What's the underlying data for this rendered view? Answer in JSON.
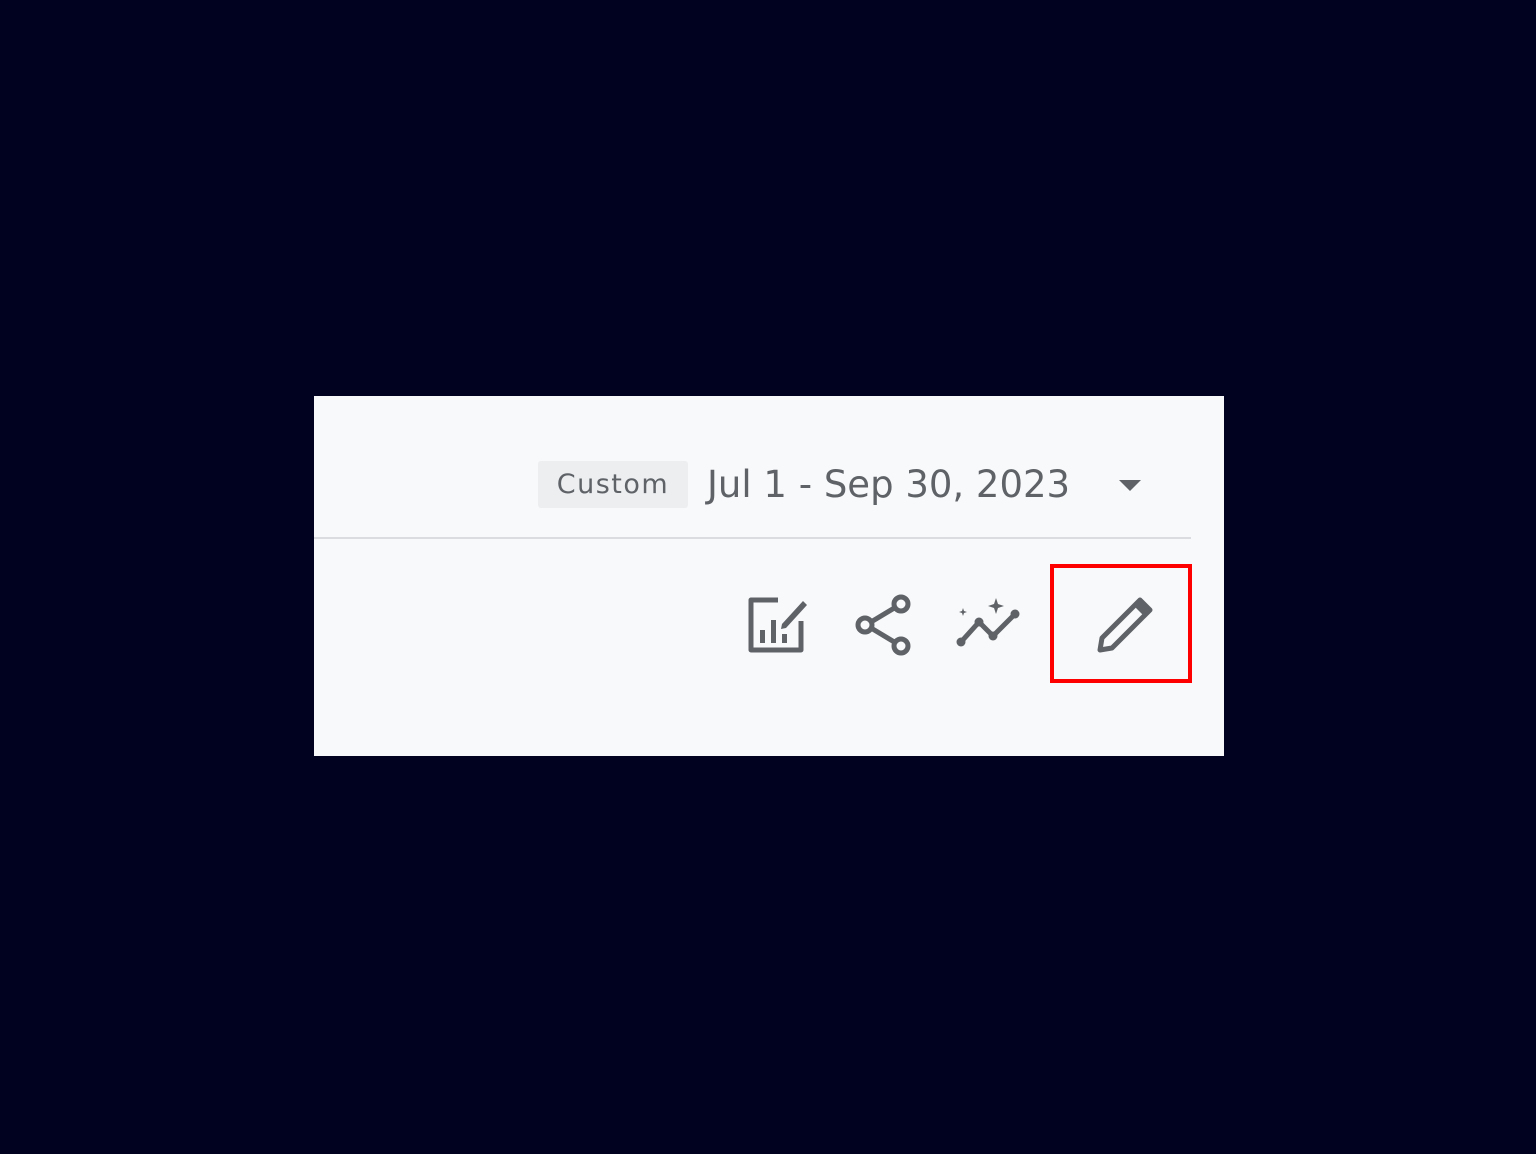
{
  "toolbar": {
    "date_preset_label": "Custom",
    "date_range_value": "Jul 1 - Sep 30, 2023",
    "date_dropdown_icon": "arrow-drop-down-icon",
    "actions": [
      {
        "icon": "customize-report-icon"
      },
      {
        "icon": "share-icon"
      },
      {
        "icon": "insights-icon"
      },
      {
        "icon": "edit-pencil-icon"
      }
    ]
  },
  "annotation": {
    "highlight_target": "edit-pencil-icon",
    "highlight_color": "#ff0000"
  },
  "colors": {
    "backdrop": "#00021f",
    "panel": "#f8f9fa",
    "icon": "#5f6368"
  }
}
